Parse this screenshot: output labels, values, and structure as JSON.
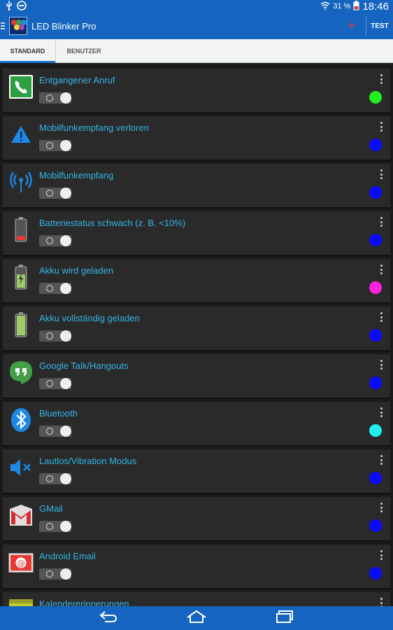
{
  "status": {
    "battery_percent": "31 %",
    "time": "18:46"
  },
  "app": {
    "title": "LED Blinker Pro",
    "add_label": "+",
    "test_label": "TEST"
  },
  "tabs": [
    {
      "label": "STANDARD",
      "active": true
    },
    {
      "label": "BENUTZER",
      "active": false
    }
  ],
  "items": [
    {
      "label": "Entgangener Anruf",
      "icon": "phone-icon",
      "led_color": "#22ee22",
      "toggle": "O"
    },
    {
      "label": "Mobilfunkempfang verloren",
      "icon": "warning-icon",
      "led_color": "#0a0aff",
      "toggle": "O"
    },
    {
      "label": "Mobilfunkempfang",
      "icon": "signal-icon",
      "led_color": "#0a0aff",
      "toggle": "O"
    },
    {
      "label": "Batteriestatus schwach (z. B. <10%)",
      "icon": "battery-low-icon",
      "led_color": "#0a0aff",
      "toggle": "O"
    },
    {
      "label": "Akku wird geladen",
      "icon": "battery-charging-icon",
      "led_color": "#ff22dd",
      "toggle": "O"
    },
    {
      "label": "Akku vollständig geladen",
      "icon": "battery-full-icon",
      "led_color": "#0a0aff",
      "toggle": "O"
    },
    {
      "label": "Google Talk/Hangouts",
      "icon": "hangouts-icon",
      "led_color": "#0a0aff",
      "toggle": "O"
    },
    {
      "label": "Bluetooth",
      "icon": "bluetooth-icon",
      "led_color": "#22eeee",
      "toggle": "O"
    },
    {
      "label": "Lautlos/Vibration Modus",
      "icon": "mute-icon",
      "led_color": "#0a0aff",
      "toggle": "O"
    },
    {
      "label": "GMail",
      "icon": "gmail-icon",
      "led_color": "#0a0aff",
      "toggle": "O"
    },
    {
      "label": "Android Email",
      "icon": "email-icon",
      "led_color": "#0a0aff",
      "toggle": "O"
    },
    {
      "label": "Kalendererinnerungen",
      "icon": "calendar-icon",
      "led_color": "#0a0aff",
      "toggle": "O"
    }
  ],
  "colors": {
    "accent": "#1565c0",
    "label_text": "#33b5e5",
    "card_bg": "#2a2a2a"
  }
}
